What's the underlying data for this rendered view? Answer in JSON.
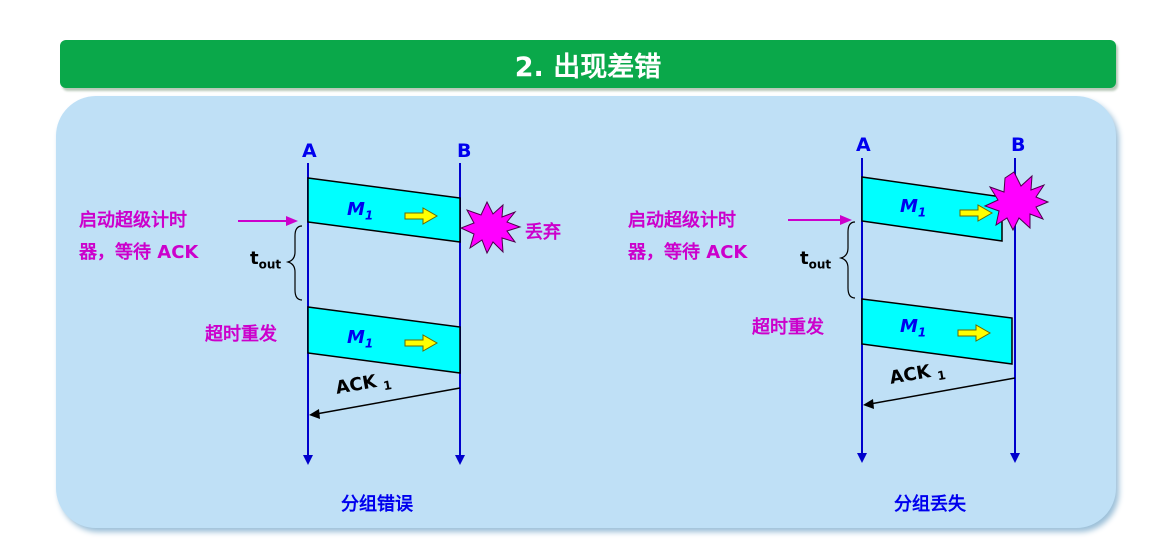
{
  "title": "2. 出现差错",
  "left": {
    "node_a": "A",
    "node_b": "B",
    "start_timer_line1": "启动超级计时",
    "start_timer_line2": "器，等待 ACK",
    "t_main": "t",
    "t_sub": "out",
    "m_main": "M",
    "m_sub": "1",
    "discard": "丢弃",
    "retransmit": "超时重发",
    "ack_main": "ACK",
    "ack_sub": "1",
    "caption": "分组错误"
  },
  "right": {
    "node_a": "A",
    "node_b": "B",
    "start_timer_line1": "启动超级计时",
    "start_timer_line2": "器，等待 ACK",
    "t_main": "t",
    "t_sub": "out",
    "m_main": "M",
    "m_sub": "1",
    "retransmit": "超时重发",
    "ack_main": "ACK",
    "ack_sub": "1",
    "caption": "分组丢失"
  },
  "colors": {
    "title_bg": "#0aa84a",
    "panel_bg": "#bfe0f6",
    "timeline": "#0000cc",
    "packet_fill": "#00ffff",
    "highlight": "#cc00cc",
    "arrow_fill": "#ffff00",
    "burst": "#ff00ff"
  }
}
